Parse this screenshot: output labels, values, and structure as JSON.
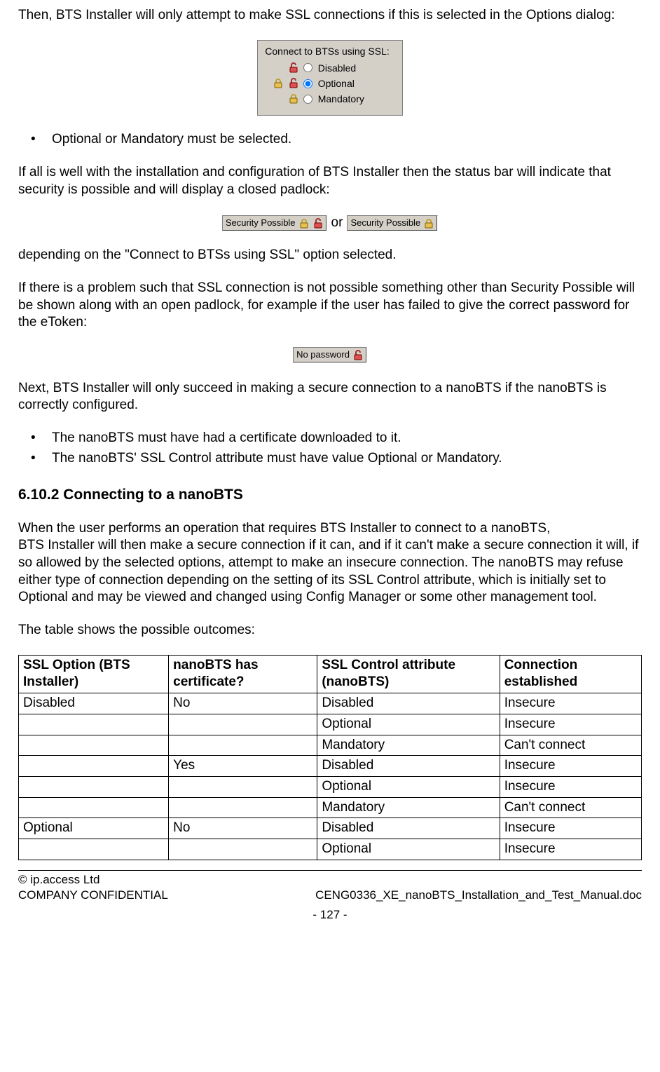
{
  "intro_para": "Then, BTS Installer will only attempt to make SSL connections if this is selected in the Options dialog:",
  "ssl_panel": {
    "title": "Connect to BTSs using SSL:",
    "options": [
      "Disabled",
      "Optional",
      "Mandatory"
    ],
    "selected": "Optional"
  },
  "bullets1": [
    "Optional or Mandatory must be selected."
  ],
  "para2": "If all is well with the installation and configuration of BTS Installer then the status bar will indicate that security is possible and will display a closed padlock:",
  "status_possible_label": "Security Possible",
  "or_word": "or",
  "para3": "depending on the \"Connect to BTSs using SSL\" option selected.",
  "para4": "If there is a problem such that SSL connection is not possible something other than Security Possible will be shown along with an open padlock, for example if the user has failed to give the correct password for the eToken:",
  "no_password_label": "No password",
  "para5": "Next, BTS Installer will only succeed in making a secure connection to a nanoBTS if the nanoBTS is correctly configured.",
  "bullets2": [
    "The nanoBTS must have had a certificate downloaded to it.",
    "The nanoBTS' SSL Control attribute must have value Optional or Mandatory."
  ],
  "section_heading": "6.10.2 Connecting to a nanoBTS",
  "para6a": "When the user performs an operation that requires BTS Installer to connect to a nanoBTS,",
  "para6b": "BTS Installer will then make a secure connection if it can, and if it can't make a secure connection it will, if so allowed by the selected options, attempt to make an insecure connection.  The nanoBTS may refuse either type of connection depending on the setting of its SSL Control attribute, which is initially set to Optional and may be viewed and changed using Config Manager or some other management tool.",
  "para7": "The table shows the possible outcomes:",
  "table": {
    "headers": [
      "SSL Option (BTS Installer)",
      "nanoBTS has certificate?",
      "SSL Control attribute (nanoBTS)",
      "Connection established"
    ],
    "rows": [
      [
        "Disabled",
        "No",
        "Disabled",
        "Insecure"
      ],
      [
        "",
        "",
        "Optional",
        "Insecure"
      ],
      [
        "",
        "",
        "Mandatory",
        "Can't connect"
      ],
      [
        "",
        "Yes",
        "Disabled",
        "Insecure"
      ],
      [
        "",
        "",
        "Optional",
        "Insecure"
      ],
      [
        "",
        "",
        "Mandatory",
        "Can't connect"
      ],
      [
        "Optional",
        "No",
        "Disabled",
        "Insecure"
      ],
      [
        "",
        "",
        "Optional",
        "Insecure"
      ]
    ]
  },
  "footer": {
    "copyright": "© ip.access Ltd",
    "confidential": "COMPANY CONFIDENTIAL",
    "doc_name": "CENG0336_XE_nanoBTS_Installation_and_Test_Manual.doc",
    "page": "- 127 -"
  }
}
